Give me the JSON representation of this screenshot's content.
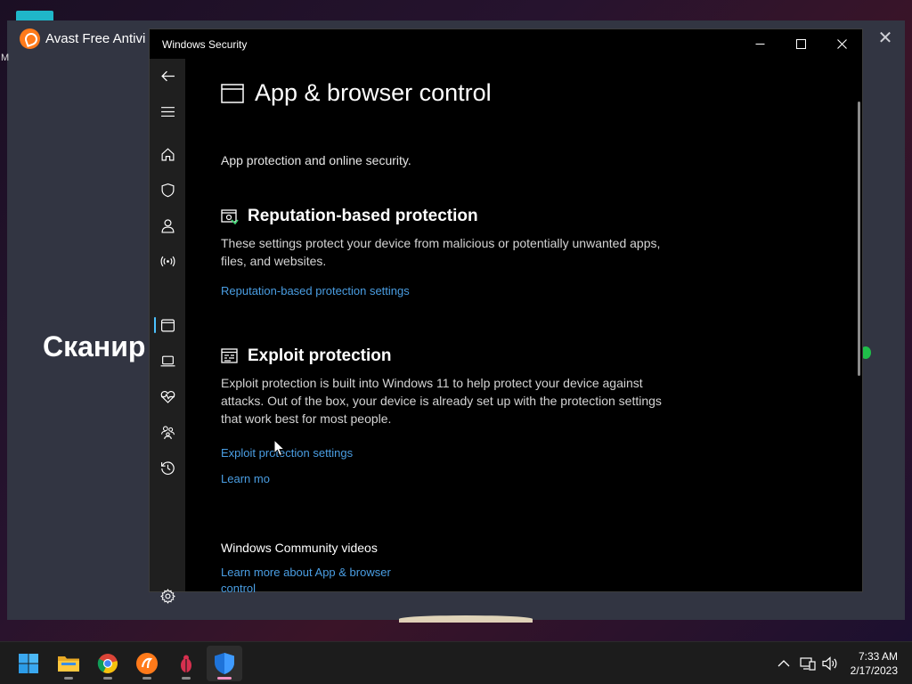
{
  "avast": {
    "title": "Avast Free Antivi",
    "side_letter": "M",
    "heading": "Сканир"
  },
  "security": {
    "window_title": "Windows Security",
    "page_title": "App & browser control",
    "page_subtitle": "App protection and online security.",
    "reputation": {
      "title": "Reputation-based protection",
      "text": "These settings protect your device from malicious or potentially unwanted apps, files, and websites.",
      "link": "Reputation-based protection settings"
    },
    "exploit": {
      "title": "Exploit protection",
      "text": "Exploit protection is built into Windows 11 to help protect your device against attacks.  Out of the box, your device is already set up with the protection settings that work best for most people.",
      "link": "Exploit protection settings",
      "learn_more": "Learn mo"
    },
    "community": {
      "heading": "Windows Community videos",
      "link_line1": "Learn more about App & browser",
      "link_line2": "control"
    },
    "nav_icons": [
      "back-arrow-icon",
      "hamburger-menu-icon",
      "home-icon",
      "shield-icon",
      "person-icon",
      "wifi-signal-icon",
      "app-browser-icon",
      "laptop-icon",
      "heart-pulse-icon",
      "family-icon",
      "history-icon",
      "gear-icon"
    ]
  },
  "taskbar": {
    "apps": [
      "windows-start-icon",
      "file-explorer-icon",
      "chrome-icon",
      "avast-icon",
      "bug-app-icon",
      "windows-security-icon"
    ],
    "time": "7:33 AM",
    "date": "2/17/2023"
  },
  "colors": {
    "link": "#4a9ee3",
    "nav_bg": "#1f1f1f",
    "accent": "#4cc2ff"
  }
}
